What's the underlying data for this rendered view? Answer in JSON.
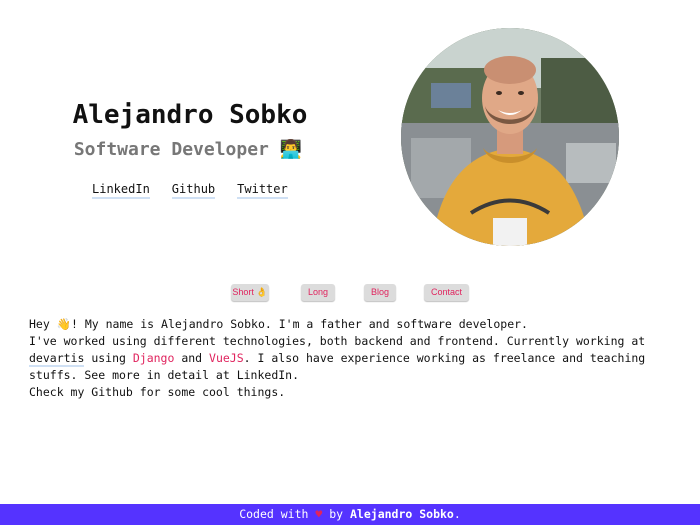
{
  "profile": {
    "name": "Alejandro Sobko",
    "role": "Software Developer 👨‍💻",
    "links": [
      {
        "label": "LinkedIn"
      },
      {
        "label": "Github"
      },
      {
        "label": "Twitter"
      }
    ]
  },
  "tabs": [
    {
      "label": "Short 👌"
    },
    {
      "label": "Long"
    },
    {
      "label": "Blog"
    },
    {
      "label": "Contact"
    }
  ],
  "bio": {
    "line1": "Hey 👋! My name is Alejandro Sobko. I'm a father and software developer.",
    "line2": "I've worked using different technologies, both backend and frontend. Currently working at",
    "company": "devartis",
    "using": " using ",
    "tech1": "Django",
    "and": " and ",
    "tech2": "VueJS",
    "line3_rest": ". I also have experience working as freelance and teaching",
    "line4": "stuffs. See more in detail at LinkedIn.",
    "line5": "Check my Github for some cool things."
  },
  "footer": {
    "prefix": "Coded with ",
    "heart": "♥",
    "by": " by ",
    "author": "Alejandro Sobko",
    "suffix": "."
  },
  "colors": {
    "accent_pink": "#e0245e",
    "footer_bg": "#5533ff",
    "link_underline": "#cfe0f4"
  }
}
